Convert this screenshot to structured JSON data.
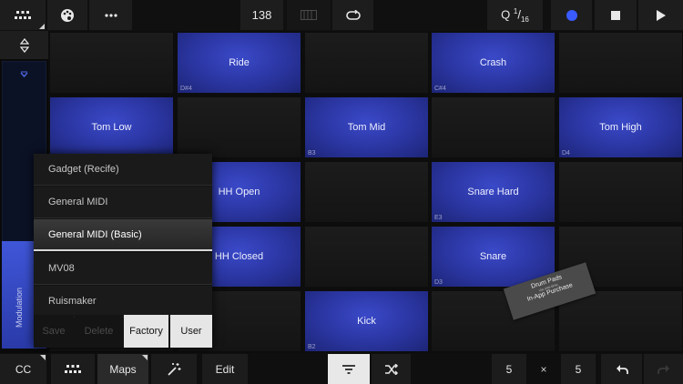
{
  "toolbar": {
    "tempo": "138",
    "quantize_prefix": "Q",
    "quantize_num": "1",
    "quantize_den": "16",
    "record_color": "#3a5bff"
  },
  "sidebar": {
    "slider_label": "Modulation",
    "slider_level_percent": 37
  },
  "pads": [
    {
      "name": "",
      "note": ""
    },
    {
      "name": "Ride",
      "note": "D#4"
    },
    {
      "name": "",
      "note": ""
    },
    {
      "name": "Crash",
      "note": "C#4"
    },
    {
      "name": "",
      "note": ""
    },
    {
      "name": "Tom Low",
      "note": ""
    },
    {
      "name": "",
      "note": ""
    },
    {
      "name": "Tom Mid",
      "note": "B3"
    },
    {
      "name": "",
      "note": ""
    },
    {
      "name": "Tom High",
      "note": "D4"
    },
    {
      "name": "",
      "note": ""
    },
    {
      "name": "HH Open",
      "note": ""
    },
    {
      "name": "",
      "note": ""
    },
    {
      "name": "Snare Hard",
      "note": "E3"
    },
    {
      "name": "",
      "note": ""
    },
    {
      "name": "",
      "note": ""
    },
    {
      "name": "HH Closed",
      "note": ""
    },
    {
      "name": "",
      "note": ""
    },
    {
      "name": "Snare",
      "note": "D3"
    },
    {
      "name": "",
      "note": ""
    },
    {
      "name": "",
      "note": ""
    },
    {
      "name": "",
      "note": ""
    },
    {
      "name": "Kick",
      "note": "B2"
    },
    {
      "name": "",
      "note": ""
    },
    {
      "name": "",
      "note": ""
    }
  ],
  "map_menu": {
    "items": [
      "Gadget (Recife)",
      "General MIDI",
      "General MIDI (Basic)",
      "MV08",
      "Ruismaker"
    ],
    "selected": "General MIDI (Basic)",
    "buttons": {
      "save": "Save",
      "delete": "Delete",
      "factory": "Factory",
      "user": "User"
    }
  },
  "sticker": {
    "line1": "Drum Pads",
    "line2": "via one-time",
    "line3": "In-App Purchase"
  },
  "bottombar": {
    "cc_label": "CC",
    "maps_label": "Maps",
    "edit_label": "Edit",
    "grid_cols": "5",
    "times": "×",
    "grid_rows": "5"
  },
  "colors": {
    "pad_active": "#2e3bb0",
    "accent": "#3a5bff"
  }
}
